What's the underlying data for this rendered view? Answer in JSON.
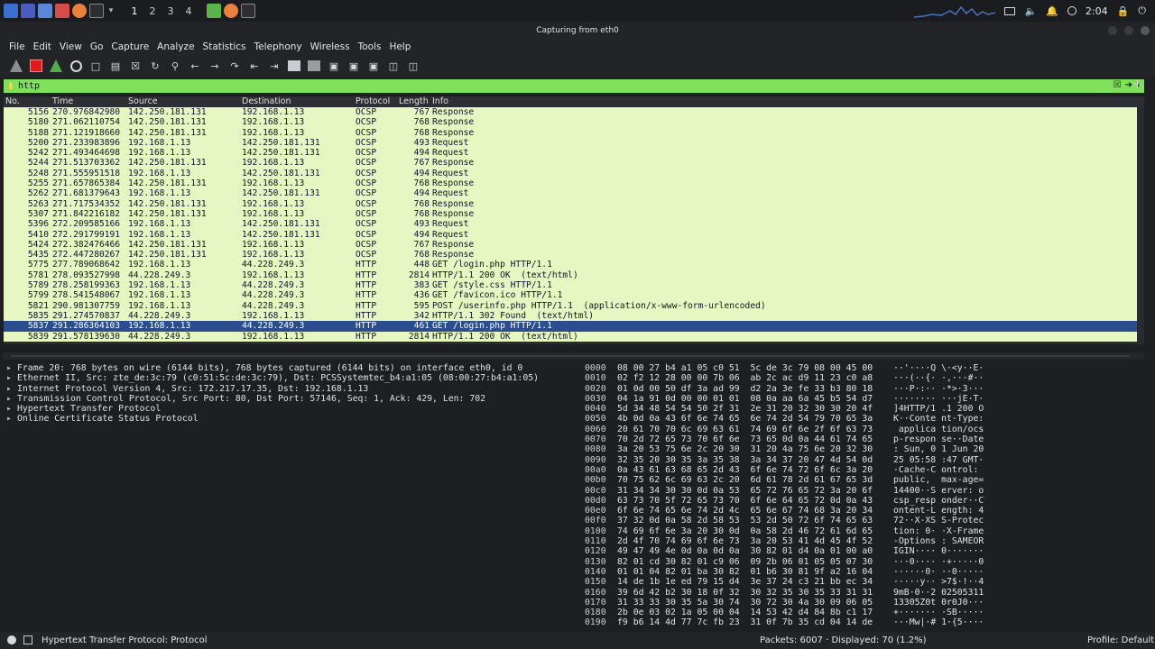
{
  "system_panel": {
    "workspaces": [
      "1",
      "2",
      "3",
      "4"
    ],
    "clock": "2:04"
  },
  "window": {
    "title": "Capturing from eth0"
  },
  "menu": [
    "File",
    "Edit",
    "View",
    "Go",
    "Capture",
    "Analyze",
    "Statistics",
    "Telephony",
    "Wireless",
    "Tools",
    "Help"
  ],
  "filter": {
    "value": "http"
  },
  "packet_list": {
    "columns": [
      "No.",
      "Time",
      "Source",
      "Destination",
      "Protocol",
      "Length",
      "Info"
    ],
    "rows": [
      [
        "5156",
        "270.976842980",
        "142.250.181.131",
        "192.168.1.13",
        "OCSP",
        "767",
        "Response"
      ],
      [
        "5180",
        "271.062110754",
        "142.250.181.131",
        "192.168.1.13",
        "OCSP",
        "768",
        "Response"
      ],
      [
        "5188",
        "271.121918660",
        "142.250.181.131",
        "192.168.1.13",
        "OCSP",
        "768",
        "Response"
      ],
      [
        "5200",
        "271.233983896",
        "192.168.1.13",
        "142.250.181.131",
        "OCSP",
        "493",
        "Request"
      ],
      [
        "5242",
        "271.493464698",
        "192.168.1.13",
        "142.250.181.131",
        "OCSP",
        "494",
        "Request"
      ],
      [
        "5244",
        "271.513703362",
        "142.250.181.131",
        "192.168.1.13",
        "OCSP",
        "767",
        "Response"
      ],
      [
        "5248",
        "271.555951518",
        "192.168.1.13",
        "142.250.181.131",
        "OCSP",
        "494",
        "Request"
      ],
      [
        "5255",
        "271.657865384",
        "142.250.181.131",
        "192.168.1.13",
        "OCSP",
        "768",
        "Response"
      ],
      [
        "5262",
        "271.681379643",
        "192.168.1.13",
        "142.250.181.131",
        "OCSP",
        "494",
        "Request"
      ],
      [
        "5263",
        "271.717534352",
        "142.250.181.131",
        "192.168.1.13",
        "OCSP",
        "768",
        "Response"
      ],
      [
        "5307",
        "271.842216182",
        "142.250.181.131",
        "192.168.1.13",
        "OCSP",
        "768",
        "Response"
      ],
      [
        "5396",
        "272.209585166",
        "192.168.1.13",
        "142.250.181.131",
        "OCSP",
        "493",
        "Request"
      ],
      [
        "5410",
        "272.291799191",
        "192.168.1.13",
        "142.250.181.131",
        "OCSP",
        "494",
        "Request"
      ],
      [
        "5424",
        "272.382476466",
        "142.250.181.131",
        "192.168.1.13",
        "OCSP",
        "767",
        "Response"
      ],
      [
        "5435",
        "272.447280267",
        "142.250.181.131",
        "192.168.1.13",
        "OCSP",
        "768",
        "Response"
      ],
      [
        "5775",
        "277.789068642",
        "192.168.1.13",
        "44.228.249.3",
        "HTTP",
        "448",
        "GET /login.php HTTP/1.1"
      ],
      [
        "5781",
        "278.093527998",
        "44.228.249.3",
        "192.168.1.13",
        "HTTP",
        "2814",
        "HTTP/1.1 200 OK  (text/html)"
      ],
      [
        "5789",
        "278.258199363",
        "192.168.1.13",
        "44.228.249.3",
        "HTTP",
        "383",
        "GET /style.css HTTP/1.1"
      ],
      [
        "5799",
        "278.541548067",
        "192.168.1.13",
        "44.228.249.3",
        "HTTP",
        "436",
        "GET /favicon.ico HTTP/1.1"
      ],
      [
        "5821",
        "290.981307759",
        "192.168.1.13",
        "44.228.249.3",
        "HTTP",
        "595",
        "POST /userinfo.php HTTP/1.1  (application/x-www-form-urlencoded)"
      ],
      [
        "5835",
        "291.274570837",
        "44.228.249.3",
        "192.168.1.13",
        "HTTP",
        "342",
        "HTTP/1.1 302 Found  (text/html)"
      ],
      [
        "5837",
        "291.286364103",
        "192.168.1.13",
        "44.228.249.3",
        "HTTP",
        "461",
        "GET /login.php HTTP/1.1"
      ],
      [
        "5839",
        "291.578139630",
        "44.228.249.3",
        "192.168.1.13",
        "HTTP",
        "2814",
        "HTTP/1.1 200 OK  (text/html)"
      ]
    ],
    "selected_index": 21
  },
  "details": [
    "Frame 20: 768 bytes on wire (6144 bits), 768 bytes captured (6144 bits) on interface eth0, id 0",
    "Ethernet II, Src: zte_de:3c:79 (c0:51:5c:de:3c:79), Dst: PCSSystemtec_b4:a1:05 (08:00:27:b4:a1:05)",
    "Internet Protocol Version 4, Src: 172.217.17.35, Dst: 192.168.1.13",
    "Transmission Control Protocol, Src Port: 80, Dst Port: 57146, Seq: 1, Ack: 429, Len: 702",
    "Hypertext Transfer Protocol",
    "Online Certificate Status Protocol"
  ],
  "hex": [
    [
      "0000",
      "08 00 27 b4 a1 05 c0 51  5c de 3c 79 08 00 45 00",
      "··'····Q \\·<y··E·"
    ],
    [
      "0010",
      "02 f2 12 28 00 00 7b 06  ab 2c ac d9 11 23 c0 a8",
      "···(··{· ·,···#··"
    ],
    [
      "0020",
      "01 0d 00 50 df 3a ad 99  d2 2a 3e fe 33 b3 80 18",
      "···P·:·· ·*>·3···"
    ],
    [
      "0030",
      "04 1a 91 0d 00 00 01 01  08 0a aa 6a 45 b5 54 d7",
      "········ ···jE·T·"
    ],
    [
      "0040",
      "5d 34 48 54 54 50 2f 31  2e 31 20 32 30 30 20 4f",
      "]4HTTP/1 .1 200 O"
    ],
    [
      "0050",
      "4b 0d 0a 43 6f 6e 74 65  6e 74 2d 54 79 70 65 3a",
      "K··Conte nt-Type:"
    ],
    [
      "0060",
      "20 61 70 70 6c 69 63 61  74 69 6f 6e 2f 6f 63 73",
      " applica tion/ocs"
    ],
    [
      "0070",
      "70 2d 72 65 73 70 6f 6e  73 65 0d 0a 44 61 74 65",
      "p-respon se··Date"
    ],
    [
      "0080",
      "3a 20 53 75 6e 2c 20 30  31 20 4a 75 6e 20 32 30",
      ": Sun, 0 1 Jun 20"
    ],
    [
      "0090",
      "32 35 20 30 35 3a 35 38  3a 34 37 20 47 4d 54 0d",
      "25 05:58 :47 GMT·"
    ],
    [
      "00a0",
      "0a 43 61 63 68 65 2d 43  6f 6e 74 72 6f 6c 3a 20",
      "·Cache-C ontrol: "
    ],
    [
      "00b0",
      "70 75 62 6c 69 63 2c 20  6d 61 78 2d 61 67 65 3d",
      "public,  max-age="
    ],
    [
      "00c0",
      "31 34 34 30 30 0d 0a 53  65 72 76 65 72 3a 20 6f",
      "14400··S erver: o"
    ],
    [
      "00d0",
      "63 73 70 5f 72 65 73 70  6f 6e 64 65 72 0d 0a 43",
      "csp_resp onder··C"
    ],
    [
      "00e0",
      "6f 6e 74 65 6e 74 2d 4c  65 6e 67 74 68 3a 20 34",
      "ontent-L ength: 4"
    ],
    [
      "00f0",
      "37 32 0d 0a 58 2d 58 53  53 2d 50 72 6f 74 65 63",
      "72··X-XS S-Protec"
    ],
    [
      "0100",
      "74 69 6f 6e 3a 20 30 0d  0a 58 2d 46 72 61 6d 65",
      "tion: 0· ·X-Frame"
    ],
    [
      "0110",
      "2d 4f 70 74 69 6f 6e 73  3a 20 53 41 4d 45 4f 52",
      "-Options : SAMEOR"
    ],
    [
      "0120",
      "49 47 49 4e 0d 0a 0d 0a  30 82 01 d4 0a 01 00 a0",
      "IGIN···· 0·······"
    ],
    [
      "0130",
      "82 01 cd 30 82 01 c9 06  09 2b 06 01 05 05 07 30",
      "···0···· ·+·····0"
    ],
    [
      "0140",
      "01 01 04 82 01 ba 30 82  01 b6 30 81 9f a2 16 04",
      "······0· ··0·····"
    ],
    [
      "0150",
      "14 de 1b 1e ed 79 15 d4  3e 37 24 c3 21 bb ec 34",
      "·····y·· >7$·!··4"
    ],
    [
      "0160",
      "39 6d 42 b2 30 18 0f 32  30 32 35 30 35 33 31 31",
      "9mB·0··2 02505311"
    ],
    [
      "0170",
      "31 33 33 30 35 5a 30 74  30 72 30 4a 30 09 06 05",
      "13305Z0t 0r0J0···"
    ],
    [
      "0180",
      "2b 0e 03 02 1a 05 00 04  14 53 42 d4 84 8b c1 17",
      "+······· ·SB·····"
    ],
    [
      "0190",
      "f9 b6 14 4d 77 7c fb 23  31 0f 7b 35 cd 04 14 de",
      "···Mw|·# 1·{5····"
    ]
  ],
  "status": {
    "left": "Hypertext Transfer Protocol: Protocol",
    "middle": "Packets: 6007 · Displayed: 70 (1.2%)",
    "right": "Profile: Default"
  },
  "colors": {
    "row_bg": "#e6f7c1",
    "selected_row_bg": "#2b4d8f",
    "filter_bg": "#7fe05a"
  }
}
